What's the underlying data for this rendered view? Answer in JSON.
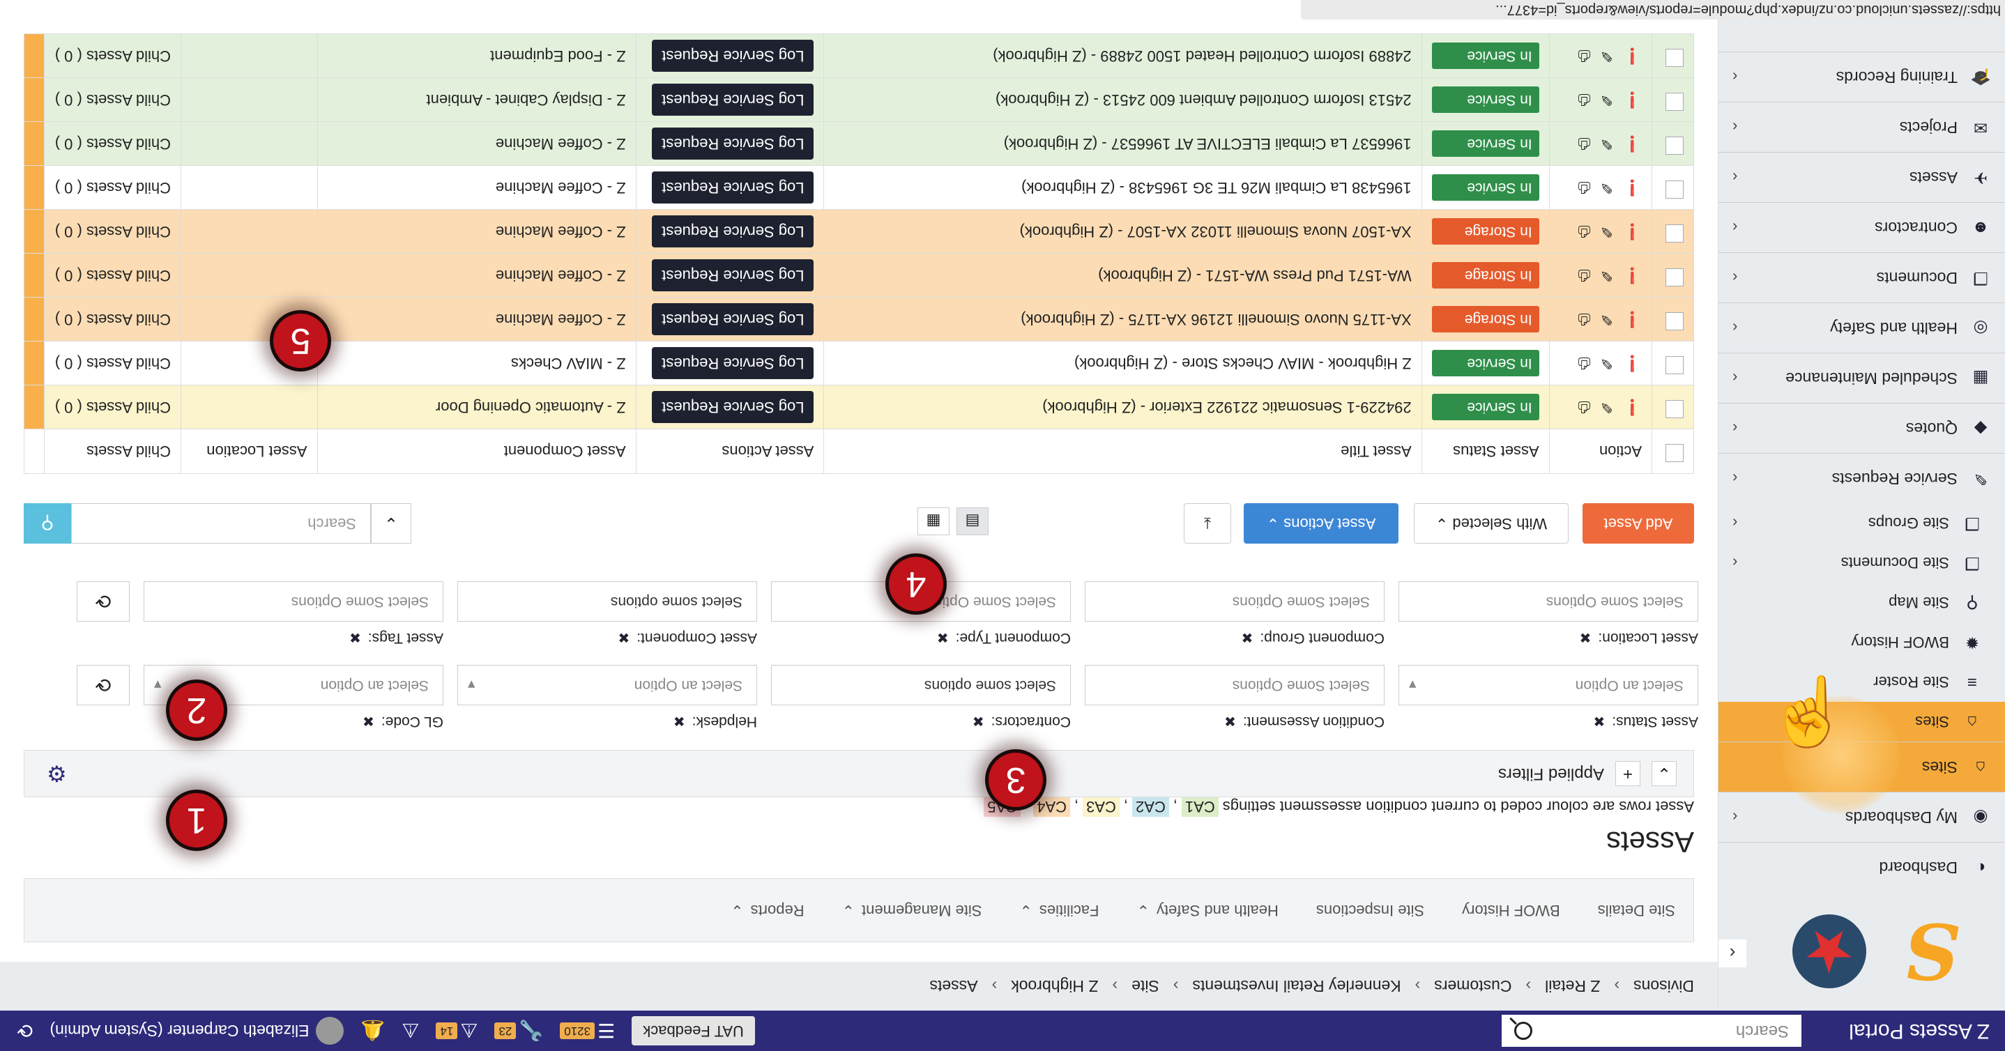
{
  "app": {
    "title": "Z Assets Portal"
  },
  "topbar": {
    "search_placeholder": "Search",
    "uat_label": "UAT Feedback",
    "count_list": "3210",
    "count_tools": "23",
    "count_alerts": "14",
    "user": "Elizabeth Carpenter (System Admin)"
  },
  "sidebar": {
    "items": [
      {
        "label": "Dashboard",
        "icon": "dashboard-icon"
      },
      {
        "label": "My Dashboards",
        "icon": "dashboards-icon"
      },
      {
        "label": "Sites",
        "icon": "sites-icon"
      },
      {
        "label": "Service Requests",
        "icon": "wrench-icon"
      },
      {
        "label": "Quotes",
        "icon": "quotes-icon"
      },
      {
        "label": "Scheduled Maintenance",
        "icon": "calendar-icon"
      },
      {
        "label": "Health and Safety",
        "icon": "safety-icon"
      },
      {
        "label": "Documents",
        "icon": "documents-icon"
      },
      {
        "label": "Contractors",
        "icon": "contractors-icon"
      },
      {
        "label": "Assets",
        "icon": "assets-icon"
      },
      {
        "label": "Projects",
        "icon": "projects-icon"
      },
      {
        "label": "Training Records",
        "icon": "training-icon"
      }
    ],
    "sub_items": [
      {
        "label": "Sites"
      },
      {
        "label": "Site Roster"
      },
      {
        "label": "BWOF History"
      },
      {
        "label": "Site Map"
      },
      {
        "label": "Site Documents"
      },
      {
        "label": "Site Groups"
      }
    ]
  },
  "breadcrumb": [
    "Divisons",
    "Z Retail",
    "Customers",
    "Kennerley Retail Investments",
    "Site",
    "Z Highbrook",
    "Assets"
  ],
  "tabs": [
    {
      "label": "Site Details",
      "dropdown": false
    },
    {
      "label": "BWOF History",
      "dropdown": false
    },
    {
      "label": "Site Inspections",
      "dropdown": false
    },
    {
      "label": "Health and Safety",
      "dropdown": true
    },
    {
      "label": "Facilities",
      "dropdown": true
    },
    {
      "label": "Site Management",
      "dropdown": true
    },
    {
      "label": "Reports",
      "dropdown": true
    }
  ],
  "page": {
    "title": "Assets",
    "legend_text": "Asset rows are colour coded to current condition assessment settings",
    "legend_codes": [
      {
        "code": "CA1",
        "color": "#dcedc8"
      },
      {
        "code": "CA2",
        "color": "#c9e6ee"
      },
      {
        "code": "CA3",
        "color": "#fbf4cc"
      },
      {
        "code": "CA4",
        "color": "#fbdcb4"
      },
      {
        "code": "CA5",
        "color": "#f8d0d0"
      }
    ],
    "applied_filters": "Applied Filters"
  },
  "filters_row1": [
    {
      "label": "Asset Status:",
      "value": "Select an Option",
      "placeholder": true,
      "select": true
    },
    {
      "label": "Condition Assesment:",
      "value": "Select Some Options",
      "placeholder": true,
      "select": false
    },
    {
      "label": "Contractors:",
      "value": "Select some options",
      "placeholder": false,
      "select": false
    },
    {
      "label": "Helpdesk:",
      "value": "Select an Option",
      "placeholder": true,
      "select": true
    },
    {
      "label": "GL Code:",
      "value": "Select an Option",
      "placeholder": true,
      "select": true
    }
  ],
  "filters_row2": [
    {
      "label": "Asset Location:",
      "value": "Select Some Options",
      "placeholder": true
    },
    {
      "label": "Component Group:",
      "value": "Select Some Options",
      "placeholder": true
    },
    {
      "label": "Component Type:",
      "value": "Select Some Options",
      "placeholder": true
    },
    {
      "label": "Asset Component:",
      "value": "Select some options",
      "placeholder": false
    },
    {
      "label": "Asset Tags:",
      "value": "Select Some Options",
      "placeholder": true
    }
  ],
  "toolbar": {
    "add": "Add Asset",
    "with_selected": "With Selected",
    "asset_actions": "Asset Actions",
    "search_placeholder": "Search"
  },
  "table": {
    "headers": [
      "Action",
      "Asset Status",
      "Asset Title",
      "Asset Actions",
      "Asset Component",
      "Asset Location",
      "Child Assets"
    ],
    "rows": [
      {
        "status": "In Service",
        "kind": "in",
        "title": "294229-1 Sensomatic 221922 Exterior - (Z Highbrook)",
        "action": "Log Service Request",
        "component": "Z - Automatic Opening Door",
        "location": "",
        "child": "Child Assets ( 0 )",
        "color": "yellow"
      },
      {
        "status": "In Service",
        "kind": "in",
        "title": "Z Highbrook - MIAV Checks Store - (Z Highbrook)",
        "action": "Log Service Request",
        "component": "Z - MIAV Checks",
        "location": "",
        "child": "Child Assets ( 0 )",
        "color": "white"
      },
      {
        "status": "In Storage",
        "kind": "store",
        "title": "XA-1175 Nuovo Simonelli 12196 XA-1175 - (Z Highbrook)",
        "action": "Log Service Request",
        "component": "Z - Coffee Machine",
        "location": "",
        "child": "Child Assets ( 0 )",
        "color": "orange"
      },
      {
        "status": "In Storage",
        "kind": "store",
        "title": "WA-1571 Pud Press WA-1571 - (Z Highbrook)",
        "action": "Log Service Request",
        "component": "Z - Coffee Machine",
        "location": "",
        "child": "Child Assets ( 0 )",
        "color": "orange"
      },
      {
        "status": "In Storage",
        "kind": "store",
        "title": "XA-1507 Nuova Simonelli 11032 XA-1507 - (Z Highbrook)",
        "action": "Log Service Request",
        "component": "Z - Coffee Machine",
        "location": "",
        "child": "Child Assets ( 0 )",
        "color": "orange"
      },
      {
        "status": "In Service",
        "kind": "in",
        "title": "1965438 La Cimbali M26 TE 3G 1965438 - (Z Highbrook)",
        "action": "Log Service Request",
        "component": "Z - Coffee Machine",
        "location": "",
        "child": "Child Assets ( 0 )",
        "color": "white"
      },
      {
        "status": "In Service",
        "kind": "in",
        "title": "1966537 La Cimbali ELECTIVE AT 1966537 - (Z Highbrook)",
        "action": "Log Service Request",
        "component": "Z - Coffee Machine",
        "location": "",
        "child": "Child Assets ( 0 )",
        "color": "green"
      },
      {
        "status": "In Service",
        "kind": "in",
        "title": "24513 Isoform Controlled Ambient 600 24513 - (Z Highbrook)",
        "action": "Log Service Request",
        "component": "Z - Display Cabinet - Ambient",
        "location": "",
        "child": "Child Assets ( 0 )",
        "color": "green"
      },
      {
        "status": "In Service",
        "kind": "in",
        "title": "24889 Isoform Controlled Heated 1500 24889 - (Z Highbrook)",
        "action": "Log Service Request",
        "component": "Z - Food Equipment",
        "location": "",
        "child": "Child Assets ( 0 )",
        "color": "green"
      }
    ]
  },
  "callouts": [
    "1",
    "2",
    "3",
    "4",
    "5"
  ],
  "status_url": "https://zassets.unicloud.co.nz/index.php?module=reports/view&reports_id=4377..."
}
